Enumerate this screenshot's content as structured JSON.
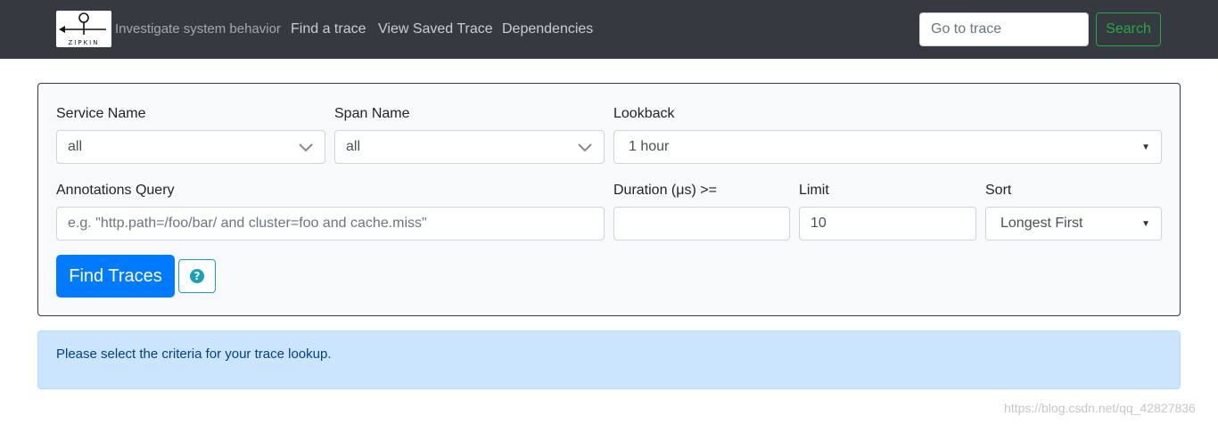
{
  "header": {
    "logo_text": "ZIPKIN",
    "tagline": "Investigate system behavior",
    "nav": [
      {
        "label": "Find a trace"
      },
      {
        "label": "View Saved Trace"
      },
      {
        "label": "Dependencies"
      }
    ],
    "goto_placeholder": "Go to trace",
    "search_label": "Search"
  },
  "form": {
    "service_name": {
      "label": "Service Name",
      "value": "all"
    },
    "span_name": {
      "label": "Span Name",
      "value": "all"
    },
    "lookback": {
      "label": "Lookback",
      "value": "1 hour"
    },
    "annotations": {
      "label": "Annotations Query",
      "placeholder": "e.g. \"http.path=/foo/bar/ and cluster=foo and cache.miss\""
    },
    "duration": {
      "label": "Duration (μs) >=",
      "value": ""
    },
    "limit": {
      "label": "Limit",
      "value": "10"
    },
    "sort": {
      "label": "Sort",
      "value": "Longest First"
    },
    "find_label": "Find Traces",
    "help_glyph": "?"
  },
  "alert": {
    "message": "Please select the criteria for your trace lookup."
  },
  "watermark": "https://blog.csdn.net/qq_42827836",
  "colors": {
    "navbar": "#343a40",
    "primary": "#007bff",
    "success": "#28a745",
    "info": "#17a2b8",
    "alert_bg": "#cce5ff"
  }
}
